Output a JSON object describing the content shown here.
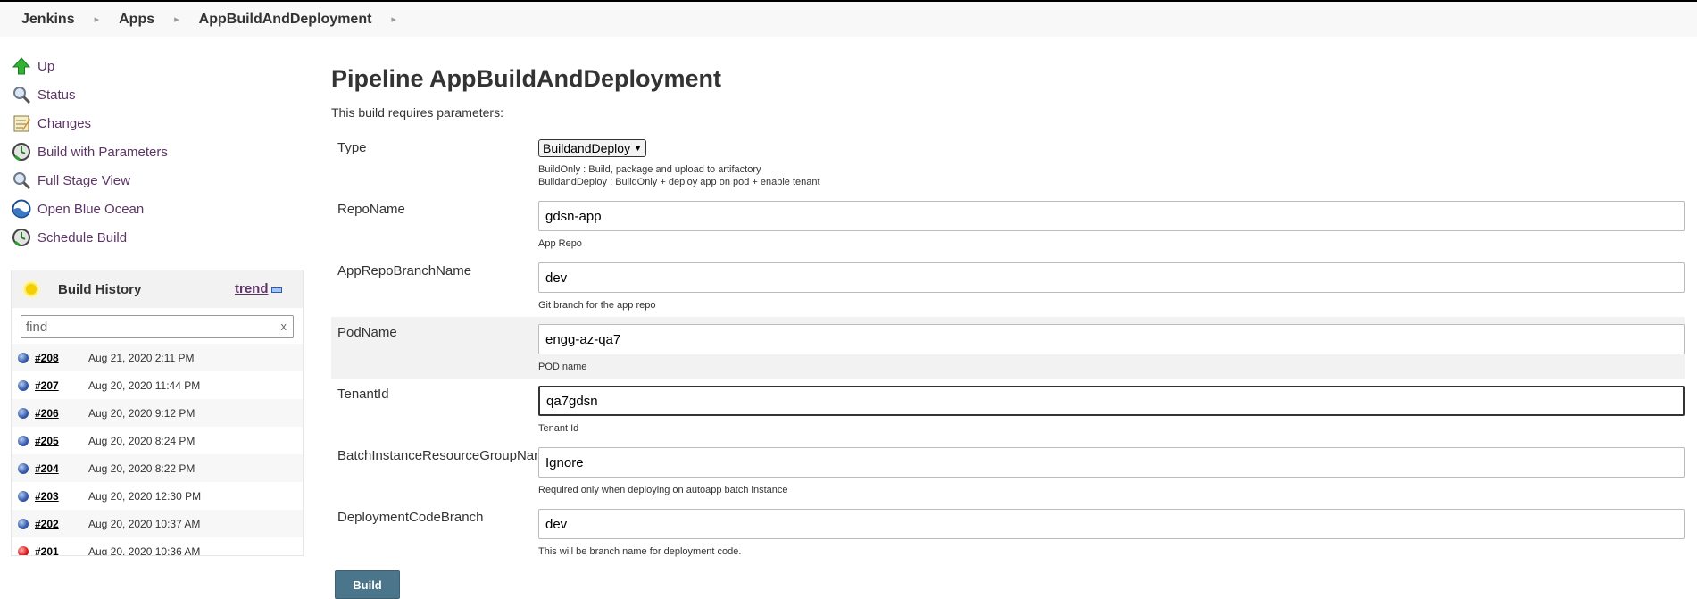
{
  "breadcrumb": [
    "Jenkins",
    "Apps",
    "AppBuildAndDeployment"
  ],
  "tasks": [
    {
      "label": "Up",
      "icon": "up-arrow-icon"
    },
    {
      "label": "Status",
      "icon": "magnifier-icon"
    },
    {
      "label": "Changes",
      "icon": "notepad-icon"
    },
    {
      "label": "Build with Parameters",
      "icon": "clock-icon"
    },
    {
      "label": "Full Stage View",
      "icon": "magnifier-icon"
    },
    {
      "label": "Open Blue Ocean",
      "icon": "blue-ocean-icon"
    },
    {
      "label": "Schedule Build",
      "icon": "clock-icon"
    }
  ],
  "build_history": {
    "title": "Build History",
    "trend_label": "trend",
    "search_placeholder": "find",
    "clear_label": "x",
    "builds": [
      {
        "number": "#208",
        "date": "Aug 21, 2020 2:11 PM",
        "status": "blue"
      },
      {
        "number": "#207",
        "date": "Aug 20, 2020 11:44 PM",
        "status": "blue"
      },
      {
        "number": "#206",
        "date": "Aug 20, 2020 9:12 PM",
        "status": "blue"
      },
      {
        "number": "#205",
        "date": "Aug 20, 2020 8:24 PM",
        "status": "blue"
      },
      {
        "number": "#204",
        "date": "Aug 20, 2020 8:22 PM",
        "status": "blue"
      },
      {
        "number": "#203",
        "date": "Aug 20, 2020 12:30 PM",
        "status": "blue"
      },
      {
        "number": "#202",
        "date": "Aug 20, 2020 10:37 AM",
        "status": "blue"
      },
      {
        "number": "#201",
        "date": "Aug 20, 2020 10:36 AM",
        "status": "red"
      }
    ]
  },
  "main": {
    "title": "Pipeline AppBuildAndDeployment",
    "intro": "This build requires parameters:",
    "type_param": {
      "label": "Type",
      "selected": "BuildandDeploy",
      "desc_1": "BuildOnly : Build, package and upload to artifactory",
      "desc_2": "BuildandDeploy : BuildOnly + deploy app on pod + enable tenant"
    },
    "params": [
      {
        "label": "RepoName",
        "value": "gdsn-app",
        "desc": "App Repo"
      },
      {
        "label": "AppRepoBranchName",
        "value": "dev",
        "desc": "Git branch for the app repo"
      },
      {
        "label": "PodName",
        "value": "engg-az-qa7",
        "desc": "POD name"
      },
      {
        "label": "TenantId",
        "value": "qa7gdsn",
        "desc": "Tenant Id"
      },
      {
        "label": "BatchInstanceResourceGroupName",
        "value": "Ignore",
        "desc": "Required only when deploying on autoapp batch instance"
      },
      {
        "label": "DeploymentCodeBranch",
        "value": "dev",
        "desc": "This will be branch name for deployment code."
      }
    ],
    "build_button": "Build"
  }
}
